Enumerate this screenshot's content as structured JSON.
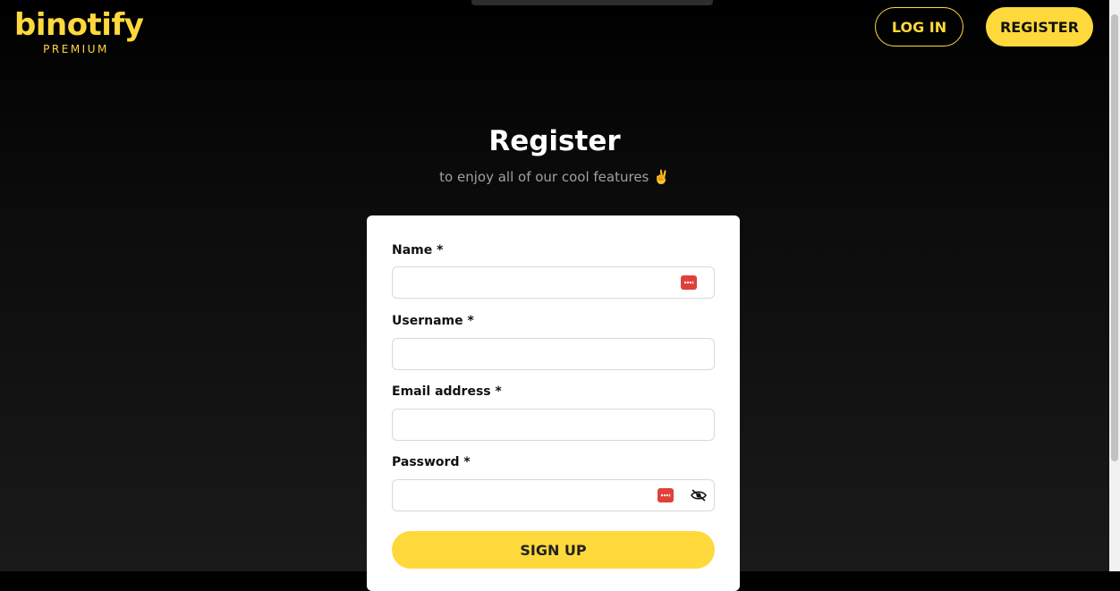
{
  "brand": {
    "name": "binotify",
    "tier": "PREMIUM"
  },
  "nav": {
    "login_label": "LOG IN",
    "register_label": "REGISTER"
  },
  "page": {
    "title": "Register",
    "subtitle": "to enjoy all of our cool features ✌️"
  },
  "form": {
    "fields": [
      {
        "label": "Name *",
        "value": ""
      },
      {
        "label": "Username *",
        "value": ""
      },
      {
        "label": "Email address *",
        "value": ""
      },
      {
        "label": "Password *",
        "value": ""
      }
    ],
    "submit_label": "SIGN UP"
  },
  "icons": {
    "password_manager": "password-manager-icon",
    "toggle_visibility": "eye-off-icon"
  },
  "colors": {
    "accent": "#ffd93b",
    "background": "#000000",
    "card": "#ffffff"
  }
}
